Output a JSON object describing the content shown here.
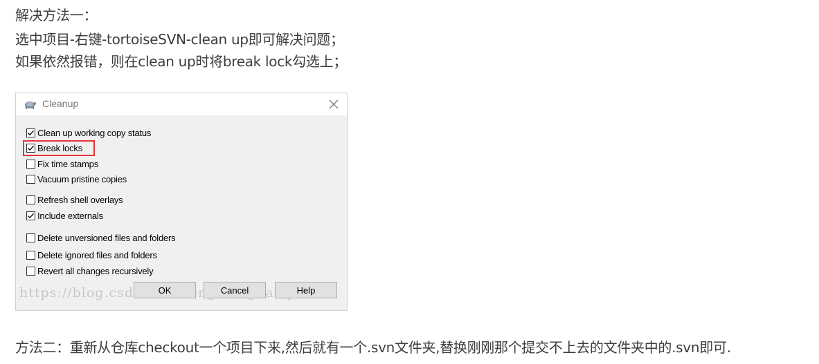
{
  "article": {
    "line1": "解决方法一：",
    "line2": "选中项目-右键-tortoiseSVN-clean up即可解决问题；",
    "line3": "如果依然报错，则在clean up时将break lock勾选上；",
    "line4": "方法二：重新从仓库checkout一个项目下来,然后就有一个.svn文件夹,替换刚刚那个提交不上去的文件夹中的.svn即可."
  },
  "dialog": {
    "title": "Cleanup",
    "icon": "tortoise-icon",
    "close_icon": "close-icon",
    "options": [
      {
        "label": "Clean up working copy status",
        "checked": true
      },
      {
        "label": "Break locks",
        "checked": true,
        "highlighted": true
      },
      {
        "label": "Fix time stamps",
        "checked": false
      },
      {
        "label": "Vacuum pristine copies",
        "checked": false
      },
      {
        "label": "Refresh shell overlays",
        "checked": false
      },
      {
        "label": "Include externals",
        "checked": true
      },
      {
        "label": "Delete unversioned files and folders",
        "checked": false
      },
      {
        "label": "Delete ignored files and folders",
        "checked": false
      },
      {
        "label": "Revert all changes recursively",
        "checked": false
      }
    ],
    "buttons": {
      "ok": "OK",
      "cancel": "Cancel",
      "help": "Help"
    },
    "watermark": "https://blog.csdn.net/mengmengdastyle",
    "highlight_color": "#e8333a"
  }
}
